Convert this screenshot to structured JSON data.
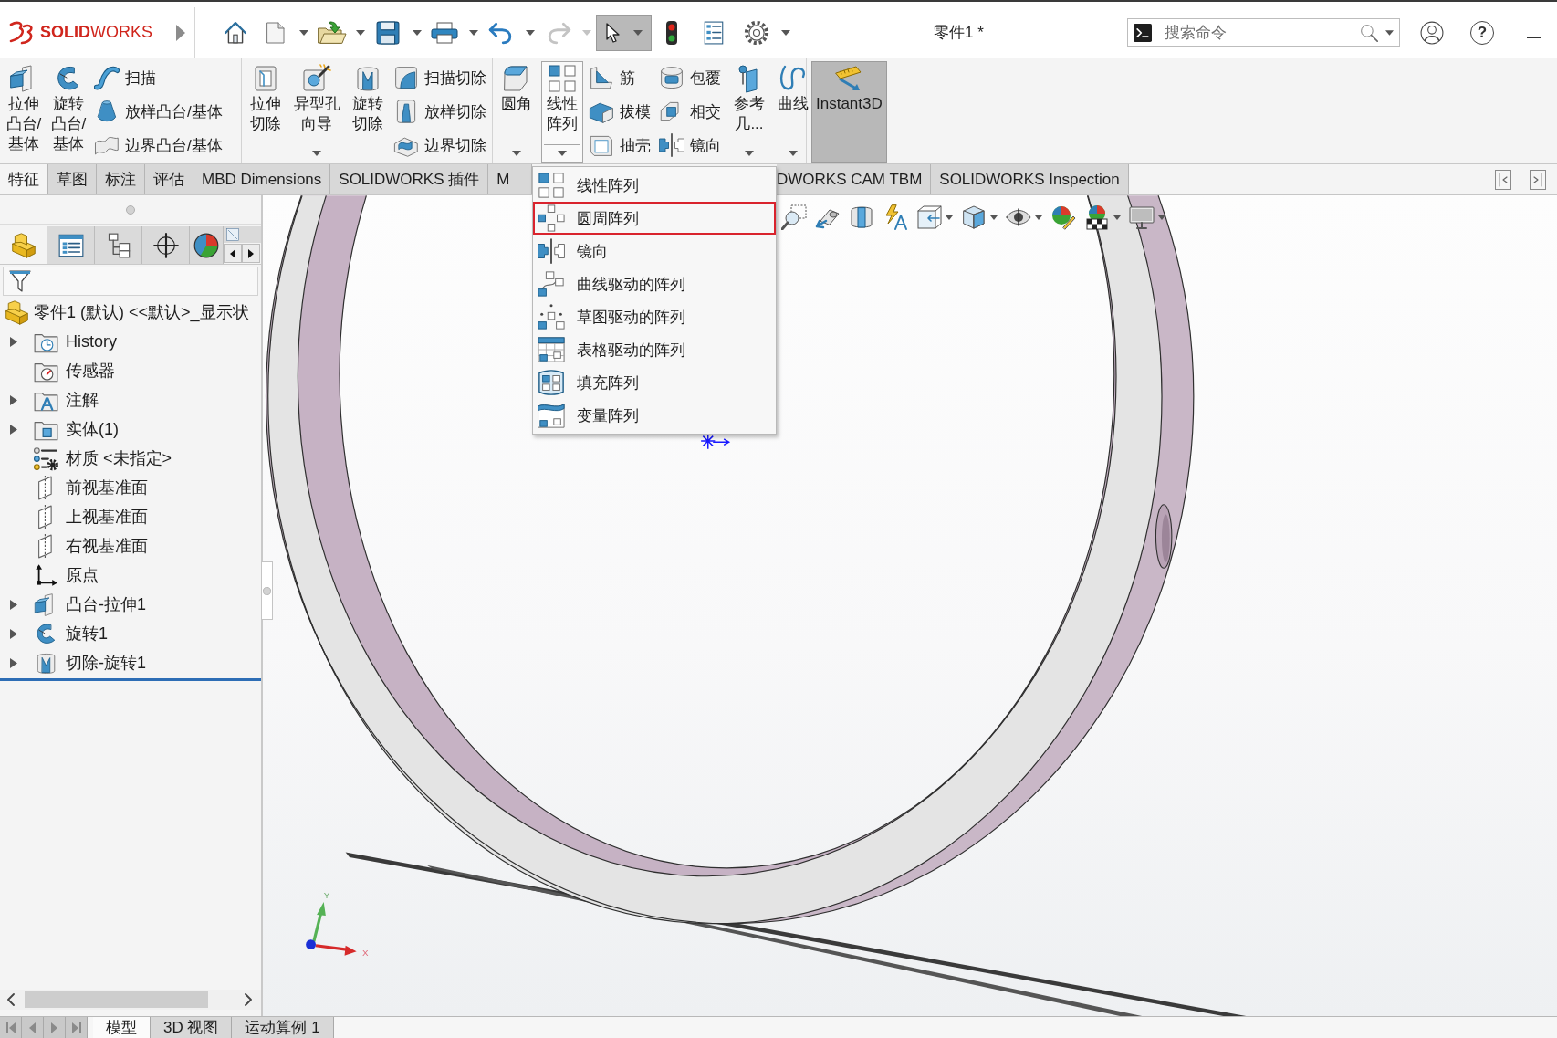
{
  "title_bar": {
    "logo": "**SOLID**WORKS",
    "quick_access": {
      "redo": {
        "disabled": true
      },
      "select_tool": {
        "selected": true
      }
    },
    "document_title": "零件1 *",
    "search": {
      "placeholder": "搜索命令"
    },
    "help": "?"
  },
  "ribbon": {
    "groups": [
      {
        "columns": [
          [
            {
              "label": "拉伸凸台/基体",
              "kind": "large",
              "dropdown": false,
              "open": false,
              "pressed": false
            }
          ],
          [
            {
              "label": "旋转凸台/基体",
              "kind": "large",
              "dropdown": false,
              "open": false,
              "pressed": false
            }
          ],
          [
            {
              "label": "扫描",
              "kind": "small",
              "dropdown": false,
              "open": false,
              "pressed": false
            },
            {
              "label": "放样凸台/基体",
              "kind": "small",
              "dropdown": false,
              "open": false,
              "pressed": false
            },
            {
              "label": "边界凸台/基体",
              "kind": "small",
              "dropdown": false,
              "open": false,
              "pressed": false
            }
          ]
        ]
      },
      {
        "columns": [
          [
            {
              "label": "拉伸切除",
              "kind": "large",
              "dropdown": false,
              "open": false,
              "pressed": false
            }
          ],
          [
            {
              "label": "异型孔向导",
              "kind": "large",
              "dropdown": true,
              "open": false,
              "pressed": false
            }
          ],
          [
            {
              "label": "旋转切除",
              "kind": "large",
              "dropdown": false,
              "open": false,
              "pressed": false
            }
          ],
          [
            {
              "label": "扫描切除",
              "kind": "small",
              "dropdown": false,
              "open": false,
              "pressed": false
            },
            {
              "label": "放样切除",
              "kind": "small",
              "dropdown": false,
              "open": false,
              "pressed": false
            },
            {
              "label": "边界切除",
              "kind": "small",
              "dropdown": false,
              "open": false,
              "pressed": false
            }
          ]
        ]
      },
      {
        "columns": [
          [
            {
              "label": "圆角",
              "kind": "large",
              "dropdown": true,
              "open": false,
              "pressed": false
            }
          ],
          [
            {
              "label": "线性阵列",
              "kind": "large",
              "dropdown": true,
              "open": true,
              "pressed": false
            }
          ],
          [
            {
              "label": "筋",
              "kind": "small",
              "dropdown": false,
              "open": false,
              "pressed": false
            },
            {
              "label": "拔模",
              "kind": "small",
              "dropdown": false,
              "open": false,
              "pressed": false
            },
            {
              "label": "抽壳",
              "kind": "small",
              "dropdown": false,
              "open": false,
              "pressed": false
            }
          ],
          [
            {
              "label": "包覆",
              "kind": "small",
              "dropdown": false,
              "open": false,
              "pressed": false
            },
            {
              "label": "相交",
              "kind": "small",
              "dropdown": false,
              "open": false,
              "pressed": false
            },
            {
              "label": "镜向",
              "kind": "small",
              "dropdown": false,
              "open": false,
              "pressed": false
            }
          ]
        ]
      },
      {
        "columns": [
          [
            {
              "label": "参考几...",
              "kind": "large",
              "dropdown": true,
              "open": false,
              "pressed": false
            }
          ],
          [
            {
              "label": "曲线",
              "kind": "large",
              "dropdown": true,
              "open": false,
              "pressed": false
            }
          ]
        ]
      },
      {
        "columns": [
          [
            {
              "label": "Instant3D",
              "kind": "large",
              "dropdown": false,
              "open": false,
              "pressed": true
            }
          ]
        ]
      }
    ]
  },
  "command_tabs": [
    {
      "label": "特征",
      "selected": true
    },
    {
      "label": "草图",
      "selected": false
    },
    {
      "label": "标注",
      "selected": false
    },
    {
      "label": "评估",
      "selected": false
    },
    {
      "label": "MBD Dimensions",
      "selected": false
    },
    {
      "label": "SOLIDWORKS 插件",
      "selected": false
    },
    {
      "label": "M",
      "selected": false
    },
    {
      "label": "DWORKS CAM TBM",
      "selected": false
    },
    {
      "label": "SOLIDWORKS Inspection",
      "selected": false
    }
  ],
  "pattern_menu": {
    "items": [
      {
        "label": "线性阵列",
        "selected": false
      },
      {
        "label": "圆周阵列",
        "selected": true
      },
      {
        "label": "镜向",
        "selected": false
      },
      {
        "label": "曲线驱动的阵列",
        "selected": false
      },
      {
        "label": "草图驱动的阵列",
        "selected": false
      },
      {
        "label": "表格驱动的阵列",
        "selected": false
      },
      {
        "label": "填充阵列",
        "selected": false
      },
      {
        "label": "变量阵列",
        "selected": false
      }
    ]
  },
  "feature_tree": {
    "panel_tabs": [
      {
        "selected": true
      },
      {
        "selected": false
      },
      {
        "selected": false
      },
      {
        "selected": false
      },
      {
        "selected": false
      },
      {
        "selected": false
      }
    ],
    "root": {
      "label": "零件1 (默认) <<默认>_显示状",
      "children": [
        {
          "label": "History",
          "expandable": true
        },
        {
          "label": "传感器",
          "expandable": false
        },
        {
          "label": "注解",
          "expandable": true
        },
        {
          "label": "实体(1)",
          "expandable": true
        },
        {
          "label": "材质 <未指定>",
          "expandable": false
        },
        {
          "label": "前视基准面",
          "expandable": false
        },
        {
          "label": "上视基准面",
          "expandable": false
        },
        {
          "label": "右视基准面",
          "expandable": false
        },
        {
          "label": "原点",
          "expandable": false
        },
        {
          "label": "凸台-拉伸1",
          "expandable": true
        },
        {
          "label": "旋转1",
          "expandable": true
        },
        {
          "label": "切除-旋转1",
          "expandable": true
        }
      ]
    }
  },
  "viewport": {
    "triad": {
      "y_label": "Y",
      "x_label": "X"
    }
  },
  "bottom_tabs": [
    {
      "label": "模型",
      "selected": true
    },
    {
      "label": "3D 视图",
      "selected": false
    },
    {
      "label": "运动算例 1",
      "selected": false
    }
  ]
}
